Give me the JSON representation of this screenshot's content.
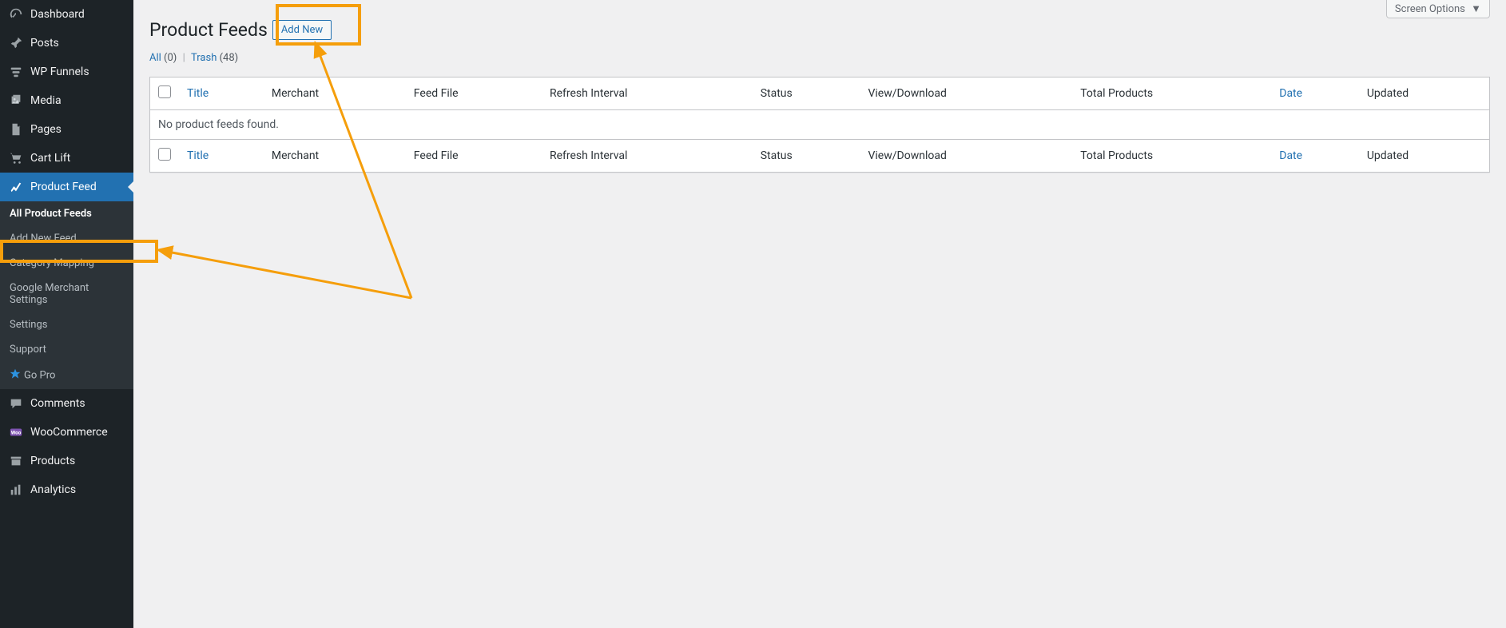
{
  "sidebar": {
    "items": [
      {
        "label": "Dashboard"
      },
      {
        "label": "Posts"
      },
      {
        "label": "WP Funnels"
      },
      {
        "label": "Media"
      },
      {
        "label": "Pages"
      },
      {
        "label": "Cart Lift"
      },
      {
        "label": "Product Feed"
      },
      {
        "label": "Comments"
      },
      {
        "label": "WooCommerce"
      },
      {
        "label": "Products"
      },
      {
        "label": "Analytics"
      }
    ],
    "product_feed_submenu": [
      {
        "label": "All Product Feeds"
      },
      {
        "label": "Add New Feed"
      },
      {
        "label": "Category Mapping"
      },
      {
        "label": "Google Merchant Settings"
      },
      {
        "label": "Settings"
      },
      {
        "label": "Support"
      },
      {
        "label": "Go Pro"
      }
    ]
  },
  "top": {
    "screen_options": "Screen Options"
  },
  "page": {
    "title": "Product Feeds",
    "add_new_label": "Add New"
  },
  "filters": {
    "all_label": "All",
    "all_count": "(0)",
    "trash_label": "Trash",
    "trash_count": "(48)"
  },
  "table": {
    "columns": {
      "title": "Title",
      "merchant": "Merchant",
      "feed_file": "Feed File",
      "refresh_interval": "Refresh Interval",
      "status": "Status",
      "view_download": "View/Download",
      "total_products": "Total Products",
      "date": "Date",
      "updated": "Updated"
    },
    "empty_message": "No product feeds found."
  }
}
